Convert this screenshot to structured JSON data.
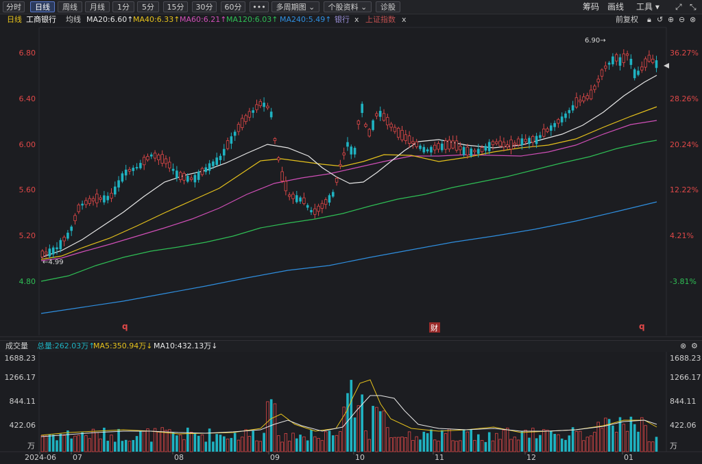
{
  "toolbar": {
    "periods": [
      "分时",
      "日线",
      "周线",
      "月线",
      "1分",
      "5分",
      "15分",
      "30分",
      "60分",
      "•••",
      "多周期图 ⌄",
      "个股资料 ⌄",
      "诊股"
    ],
    "active_index": 1,
    "right_items": [
      "筹码",
      "画线",
      "工具 ▾"
    ]
  },
  "ma_bar": {
    "period": "日线",
    "stock": "工商银行",
    "avg_label": "均线",
    "ma20": "MA20:6.60↑",
    "ma40": "MA40:6.33↑",
    "ma60": "MA60:6.21↑",
    "ma120": "MA120:6.03↑",
    "ma240": "MA240:5.49↑",
    "overlay1": "银行",
    "overlay2": "上证指数",
    "close_mark": "x",
    "adjust": "前复权"
  },
  "colors": {
    "up": "#e04848",
    "down": "#1fb3c2",
    "ma20": "#e8e8e8",
    "ma40": "#e6c21c",
    "ma60": "#d14fb8",
    "ma120": "#2fbf55",
    "ma240": "#2f8fe0"
  },
  "price_axis": {
    "left_ticks": [
      "6.80",
      "6.40",
      "6.00",
      "5.60",
      "5.20",
      "4.80"
    ],
    "right_ticks": [
      "36.27%",
      "28.26%",
      "20.24%",
      "12.22%",
      "4.21%",
      "-3.81%"
    ]
  },
  "annotations": {
    "high": "6.90→",
    "low": "←4.99",
    "marker_q": "q",
    "marker_cai": "财"
  },
  "volume_bar": {
    "label": "成交量",
    "total": "总量:262.03万↑",
    "ma5": "MA5:350.94万↓",
    "ma10": "MA10:432.13万↓"
  },
  "volume_axis": {
    "ticks": [
      "1688.23",
      "1266.17",
      "844.11",
      "422.06"
    ],
    "unit": "万"
  },
  "date_axis": [
    "2024-06",
    "07",
    "08",
    "09",
    "10",
    "11",
    "12",
    "01"
  ],
  "chart_data": {
    "type": "candlestick",
    "price_range": [
      4.8,
      6.9
    ],
    "high_marker": 6.9,
    "low_marker": 4.99,
    "moving_averages": {
      "MA20": 6.6,
      "MA40": 6.33,
      "MA60": 6.21,
      "MA120": 6.03,
      "MA240": 5.49
    },
    "volume_range": [
      0,
      1688.23
    ],
    "volume_unit": "万",
    "volume_total": 262.03,
    "volume_ma5": 350.94,
    "volume_ma10": 432.13
  }
}
